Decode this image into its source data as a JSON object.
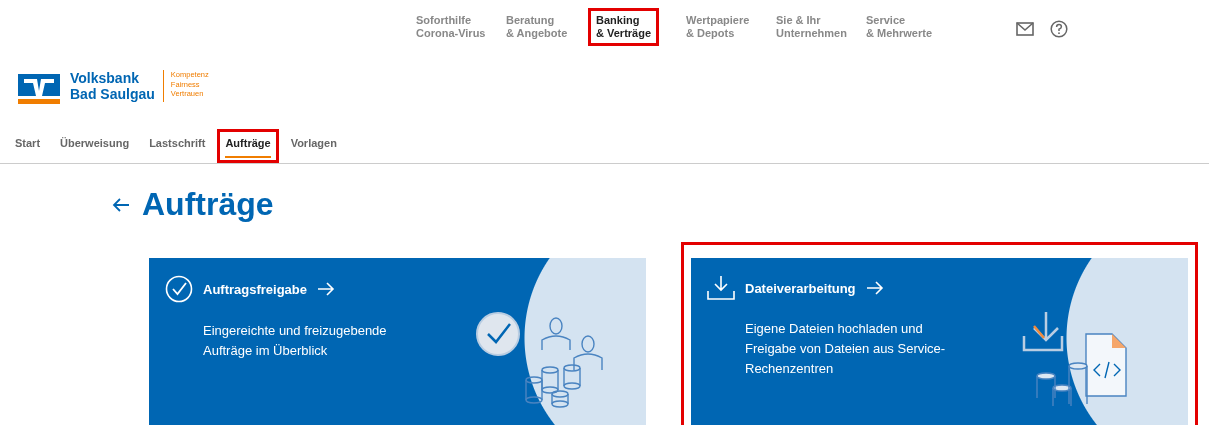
{
  "top_nav": [
    {
      "lines": [
        "Soforthilfe",
        "Corona-Virus"
      ],
      "selected": false,
      "highlighted": false
    },
    {
      "lines": [
        "Beratung",
        "& Angebote"
      ],
      "selected": false,
      "highlighted": false
    },
    {
      "lines": [
        "Banking",
        "& Verträge"
      ],
      "selected": true,
      "highlighted": true
    },
    {
      "lines": [
        "Wertpapiere",
        "& Depots"
      ],
      "selected": false,
      "highlighted": false
    },
    {
      "lines": [
        "Sie & Ihr",
        "Unternehmen"
      ],
      "selected": false,
      "highlighted": false
    },
    {
      "lines": [
        "Service",
        "& Mehrwerte"
      ],
      "selected": false,
      "highlighted": false
    }
  ],
  "logo": {
    "name_lines": [
      "Volksbank",
      "Bad Saulgau"
    ],
    "tagline": [
      "Kompetenz",
      "Fairness",
      "Vertrauen"
    ]
  },
  "tabs": [
    {
      "label": "Start",
      "selected": false,
      "highlighted": false
    },
    {
      "label": "Überweisung",
      "selected": false,
      "highlighted": false
    },
    {
      "label": "Lastschrift",
      "selected": false,
      "highlighted": false
    },
    {
      "label": "Aufträge",
      "selected": true,
      "highlighted": true
    },
    {
      "label": "Vorlagen",
      "selected": false,
      "highlighted": false
    }
  ],
  "page_title": "Aufträge",
  "cards": [
    {
      "kind": "approval",
      "title": "Auftragsfreigabe",
      "description": "Eingereichte und freizugebende Aufträge im Überblick",
      "highlighted": false
    },
    {
      "kind": "files",
      "title": "Dateiverarbeitung",
      "description": "Eigene Dateien hochladen und Freigabe von Dateien aus Service-Rechenzentren",
      "highlighted": true
    }
  ]
}
